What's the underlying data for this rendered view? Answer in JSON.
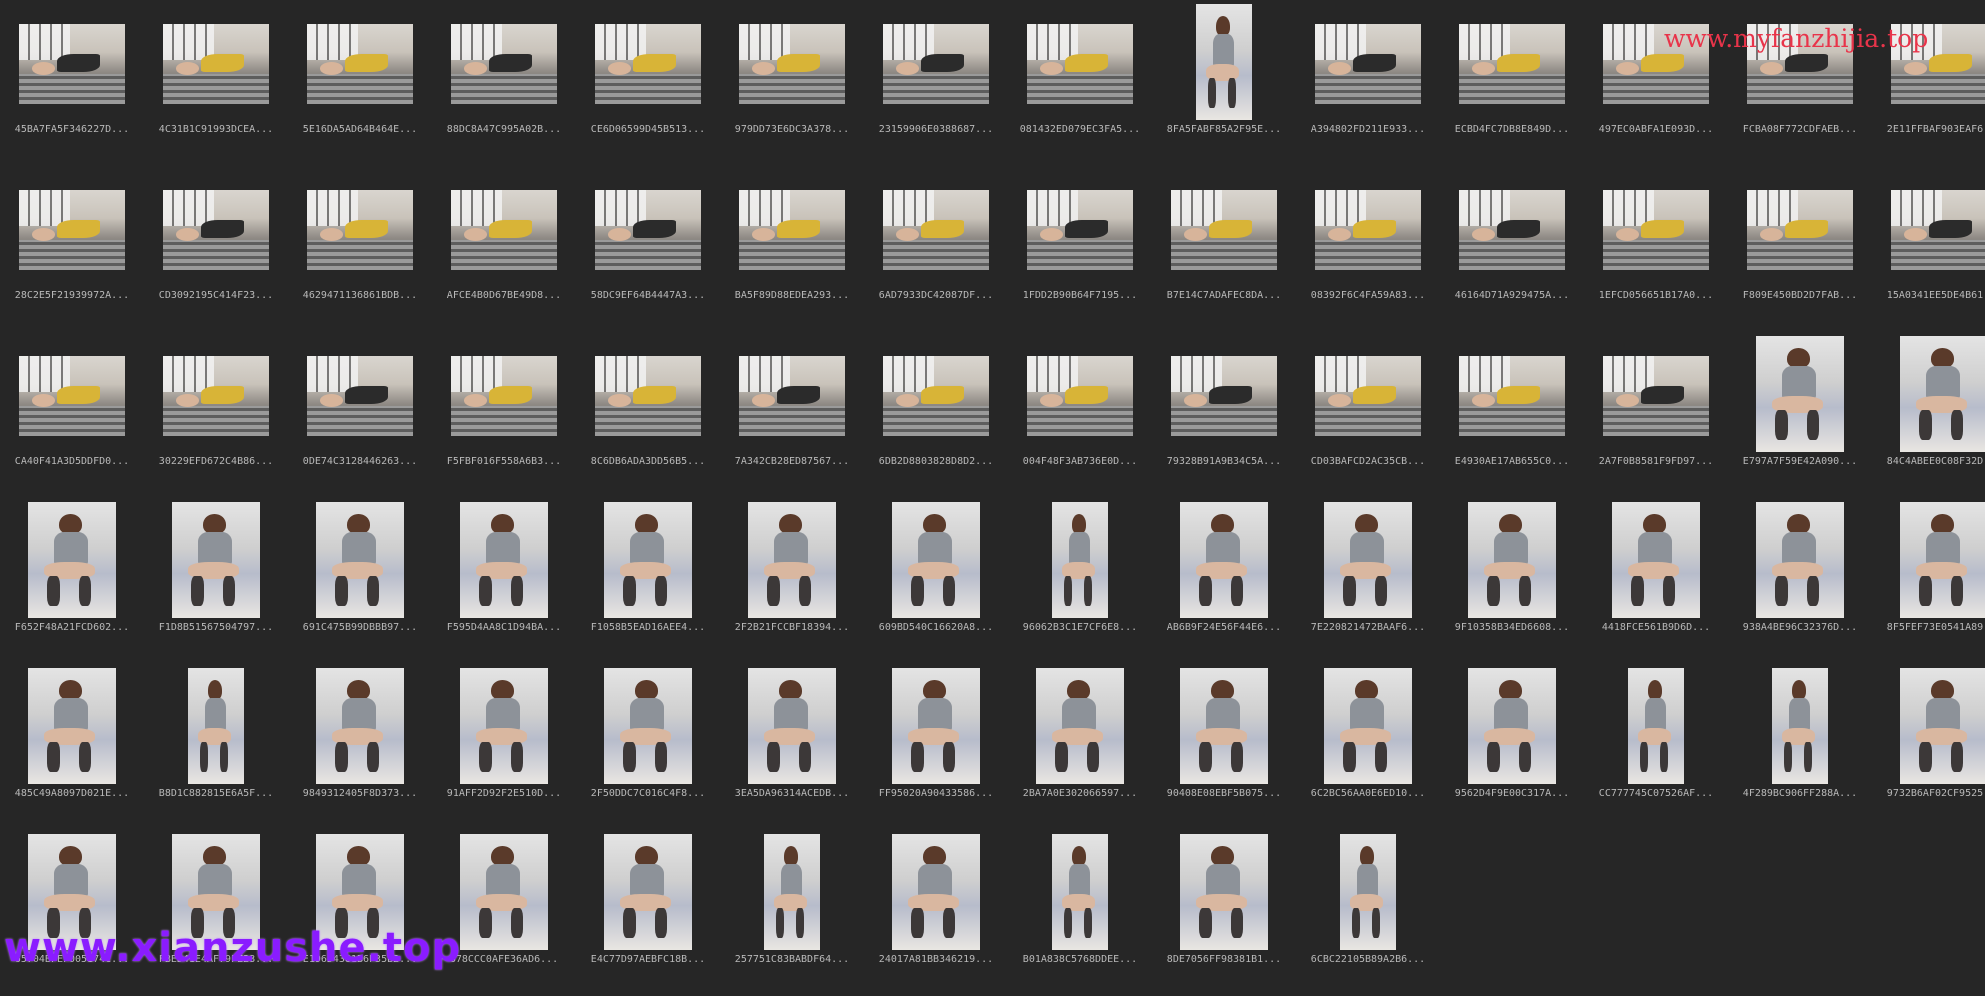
{
  "watermarks": {
    "top_right": "www.myfanzhijia.top",
    "bottom_left": "www.xianzushe.top"
  },
  "colors": {
    "background": "#262626",
    "caption": "#b9b9b9",
    "watermark_top": "#e8344a",
    "watermark_bottom": "#8a1cff"
  },
  "files": [
    {
      "name": "45BA7FA5F346227D...",
      "orientation": "landscape"
    },
    {
      "name": "4C31B1C91993DCEA...",
      "orientation": "landscape"
    },
    {
      "name": "5E16DA5AD64B464E...",
      "orientation": "landscape"
    },
    {
      "name": "88DC8A47C995A02B...",
      "orientation": "landscape"
    },
    {
      "name": "CE6D06599D45B513...",
      "orientation": "landscape"
    },
    {
      "name": "979DD73E6DC3A378...",
      "orientation": "landscape"
    },
    {
      "name": "23159906E0388687...",
      "orientation": "landscape"
    },
    {
      "name": "081432ED079EC3FA5...",
      "orientation": "landscape"
    },
    {
      "name": "8FA5FABF85A2F95E...",
      "orientation": "tall"
    },
    {
      "name": "A394802FD211E933...",
      "orientation": "landscape"
    },
    {
      "name": "ECBD4FC7DB8E849D...",
      "orientation": "landscape"
    },
    {
      "name": "497EC0ABFA1E093D...",
      "orientation": "landscape"
    },
    {
      "name": "FCBA08F772CDFAEB...",
      "orientation": "landscape"
    },
    {
      "name": "2E11FFBAF903EAF6...",
      "orientation": "landscape"
    },
    {
      "name": "28C2E5F21939972A...",
      "orientation": "landscape"
    },
    {
      "name": "CD3092195C414F23...",
      "orientation": "landscape"
    },
    {
      "name": "4629471136861BDB...",
      "orientation": "landscape"
    },
    {
      "name": "AFCE4B0D67BE49D8...",
      "orientation": "landscape"
    },
    {
      "name": "58DC9EF64B4447A3...",
      "orientation": "landscape"
    },
    {
      "name": "BA5F89D88EDEA293...",
      "orientation": "landscape"
    },
    {
      "name": "6AD7933DC42087DF...",
      "orientation": "landscape"
    },
    {
      "name": "1FDD2B90B64F7195...",
      "orientation": "landscape"
    },
    {
      "name": "B7E14C7ADAFEC8DA...",
      "orientation": "landscape"
    },
    {
      "name": "08392F6C4FA59A83...",
      "orientation": "landscape"
    },
    {
      "name": "46164D71A929475A...",
      "orientation": "landscape"
    },
    {
      "name": "1EFCD056651B17A0...",
      "orientation": "landscape"
    },
    {
      "name": "F809E450BD2D7FAB...",
      "orientation": "landscape"
    },
    {
      "name": "15A0341EE5DE4B61...",
      "orientation": "landscape"
    },
    {
      "name": "CA40F41A3D5DDFD0...",
      "orientation": "landscape"
    },
    {
      "name": "30229EFD672C4B86...",
      "orientation": "landscape"
    },
    {
      "name": "0DE74C3128446263...",
      "orientation": "landscape"
    },
    {
      "name": "F5FBF016F558A6B3...",
      "orientation": "landscape"
    },
    {
      "name": "8C6DB6ADA3DD56B5...",
      "orientation": "landscape"
    },
    {
      "name": "7A342CB28ED87567...",
      "orientation": "landscape"
    },
    {
      "name": "6DB2D8803828D8D2...",
      "orientation": "landscape"
    },
    {
      "name": "004F48F3AB736E0D...",
      "orientation": "landscape"
    },
    {
      "name": "79328B91A9B34C5A...",
      "orientation": "landscape"
    },
    {
      "name": "CD03BAFCD2AC35CB...",
      "orientation": "landscape"
    },
    {
      "name": "E4930AE17AB655C0...",
      "orientation": "landscape"
    },
    {
      "name": "2A7F0B8581F9FD97...",
      "orientation": "landscape"
    },
    {
      "name": "E797A7F59E42A090...",
      "orientation": "portrait"
    },
    {
      "name": "84C4ABEE0C08F32D...",
      "orientation": "portrait"
    },
    {
      "name": "F652F48A21FCD602...",
      "orientation": "portrait"
    },
    {
      "name": "F1D8B51567504797...",
      "orientation": "portrait"
    },
    {
      "name": "691C475B99DBBB97...",
      "orientation": "portrait"
    },
    {
      "name": "F595D4AA8C1D94BA...",
      "orientation": "portrait"
    },
    {
      "name": "F1058B5EAD16AEE4...",
      "orientation": "portrait"
    },
    {
      "name": "2F2B21FCCBF18394...",
      "orientation": "portrait"
    },
    {
      "name": "609BD540C16620A8...",
      "orientation": "portrait"
    },
    {
      "name": "96062B3C1E7CF6E8...",
      "orientation": "tall"
    },
    {
      "name": "AB6B9F24E56F44E6...",
      "orientation": "portrait"
    },
    {
      "name": "7E220821472BAAF6...",
      "orientation": "portrait"
    },
    {
      "name": "9F10358B34ED6608...",
      "orientation": "portrait"
    },
    {
      "name": "4418FCE561B9D6D...",
      "orientation": "portrait"
    },
    {
      "name": "938A4BE96C32376D...",
      "orientation": "portrait"
    },
    {
      "name": "8F5FEF73E0541A89...",
      "orientation": "portrait"
    },
    {
      "name": "485C49A8097D021E...",
      "orientation": "portrait"
    },
    {
      "name": "B8D1C882815E6A5F...",
      "orientation": "tall"
    },
    {
      "name": "9849312405F8D373...",
      "orientation": "portrait"
    },
    {
      "name": "91AFF2D92F2E510D...",
      "orientation": "portrait"
    },
    {
      "name": "2F50DDC7C016C4F8...",
      "orientation": "portrait"
    },
    {
      "name": "3EA5DA96314ACEDB...",
      "orientation": "portrait"
    },
    {
      "name": "FF95020A90433586...",
      "orientation": "portrait"
    },
    {
      "name": "2BA7A0E302066597...",
      "orientation": "portrait"
    },
    {
      "name": "90408E08EBF5B075...",
      "orientation": "portrait"
    },
    {
      "name": "6C2BC56AA0E6ED10...",
      "orientation": "portrait"
    },
    {
      "name": "9562D4F9E00C317A...",
      "orientation": "portrait"
    },
    {
      "name": "CC777745C07526AF...",
      "orientation": "tall"
    },
    {
      "name": "4F289BC906FF288A...",
      "orientation": "tall"
    },
    {
      "name": "9732B6AF02CF9525...",
      "orientation": "portrait"
    },
    {
      "name": "65704BFEF005174C...",
      "orientation": "portrait"
    },
    {
      "name": "FBED41E4AF79FE28...",
      "orientation": "portrait"
    },
    {
      "name": "E196D4381B6F35B2...",
      "orientation": "portrait"
    },
    {
      "name": "678CCC0AFE36AD6...",
      "orientation": "portrait"
    },
    {
      "name": "E4C77D97AEBFC18B...",
      "orientation": "portrait"
    },
    {
      "name": "257751C83BABDF64...",
      "orientation": "tall"
    },
    {
      "name": "24017A81BB346219...",
      "orientation": "portrait"
    },
    {
      "name": "B01A838C5768DDEE...",
      "orientation": "tall"
    },
    {
      "name": "8DE7056FF98381B1...",
      "orientation": "portrait"
    },
    {
      "name": "6CBC22105B89A2B6...",
      "orientation": "tall"
    }
  ]
}
